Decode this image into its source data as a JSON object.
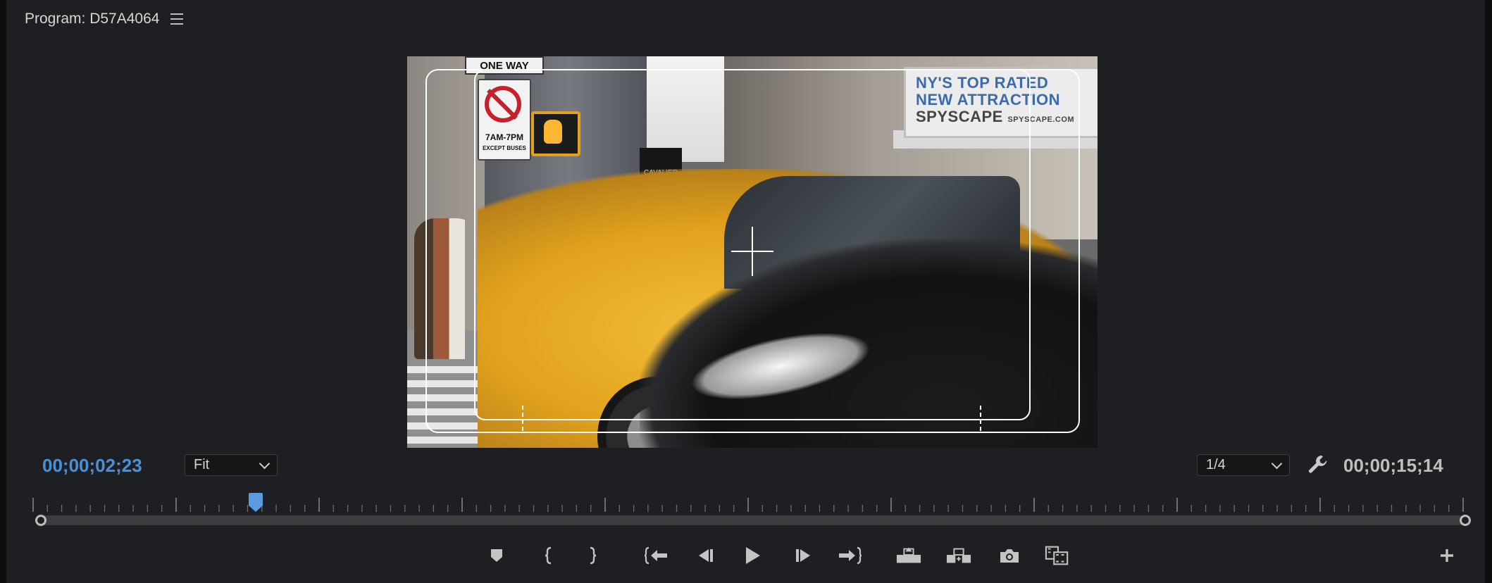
{
  "panel": {
    "title": "Program: D57A4064"
  },
  "video": {
    "sign_one_way": "ONE WAY",
    "sign_hours": "7AM-7PM",
    "sign_except": "EXCEPT BUSES",
    "billboard_line1": "NY'S TOP RATED",
    "billboard_line2": "NEW ATTRACTION",
    "billboard_line3": "SPYSCAPE",
    "billboard_url": "SPYSCAPE.COM",
    "awning_text": "CAVALIER GALLERY"
  },
  "controls": {
    "current_timecode": "00;00;02;23",
    "duration_timecode": "00;00;15;14",
    "zoom_value": "Fit",
    "resolution_value": "1/4",
    "playhead_fraction": 0.15
  },
  "transport": {
    "buttons": [
      {
        "name": "add-marker-button",
        "icon": "marker-icon"
      },
      {
        "name": "mark-in-button",
        "icon": "mark-in-icon"
      },
      {
        "name": "mark-out-button",
        "icon": "mark-out-icon"
      },
      {
        "name": "go-to-in-button",
        "icon": "go-to-in-icon"
      },
      {
        "name": "step-back-button",
        "icon": "step-back-icon"
      },
      {
        "name": "play-button",
        "icon": "play-icon"
      },
      {
        "name": "step-forward-button",
        "icon": "step-forward-icon"
      },
      {
        "name": "go-to-out-button",
        "icon": "go-to-out-icon"
      },
      {
        "name": "lift-button",
        "icon": "lift-icon"
      },
      {
        "name": "extract-button",
        "icon": "extract-icon"
      },
      {
        "name": "export-frame-button",
        "icon": "camera-icon"
      },
      {
        "name": "compare-view-button",
        "icon": "compare-icon"
      },
      {
        "name": "button-editor-button",
        "icon": "plus-icon"
      }
    ]
  }
}
